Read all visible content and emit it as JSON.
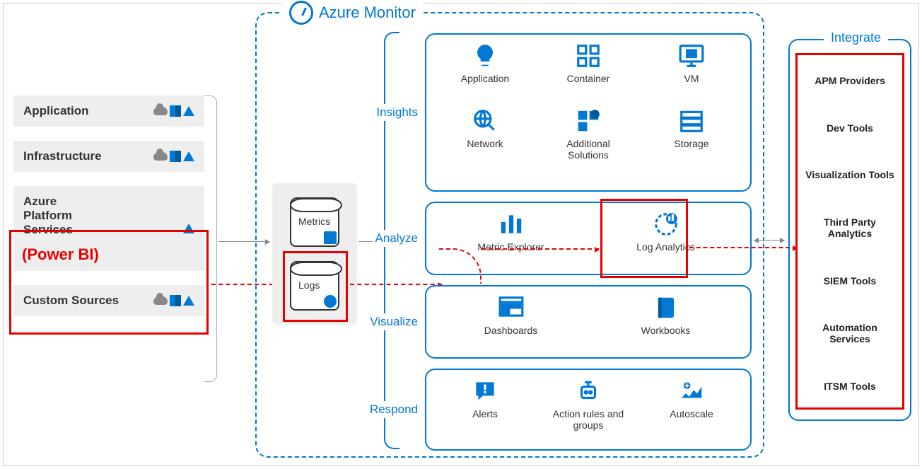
{
  "title": "Azure Monitor",
  "sources": {
    "application": "Application",
    "infrastructure": "Infrastructure",
    "azure_platform": "Azure\nPlatform\nServices",
    "powerbi_note": "(Power BI)",
    "custom": "Custom Sources"
  },
  "storage": {
    "metrics": "Metrics",
    "logs": "Logs"
  },
  "sections": {
    "insights": {
      "label": "Insights",
      "items": {
        "application": "Application",
        "container": "Container",
        "vm": "VM",
        "network": "Network",
        "solutions": "Additional Solutions",
        "storage": "Storage"
      }
    },
    "analyze": {
      "label": "Analyze",
      "items": {
        "metric_explorer": "Metric Explorer",
        "log_analytics": "Log Analytics"
      }
    },
    "visualize": {
      "label": "Visualize",
      "items": {
        "dashboards": "Dashboards",
        "workbooks": "Workbooks"
      }
    },
    "respond": {
      "label": "Respond",
      "items": {
        "alerts": "Alerts",
        "action_rules": "Action rules and groups",
        "autoscale": "Autoscale"
      }
    }
  },
  "integrate": {
    "label": "Integrate",
    "items": {
      "apm": "APM Providers",
      "dev": "Dev Tools",
      "viz": "Visualization Tools",
      "thirdparty": "Third Party Analytics",
      "siem": "SIEM Tools",
      "automation": "Automation Services",
      "itsm": "ITSM Tools"
    }
  },
  "highlights": [
    "Azure Platform Services (Power BI) source",
    "Logs storage",
    "Log Analytics",
    "Integrate column"
  ]
}
